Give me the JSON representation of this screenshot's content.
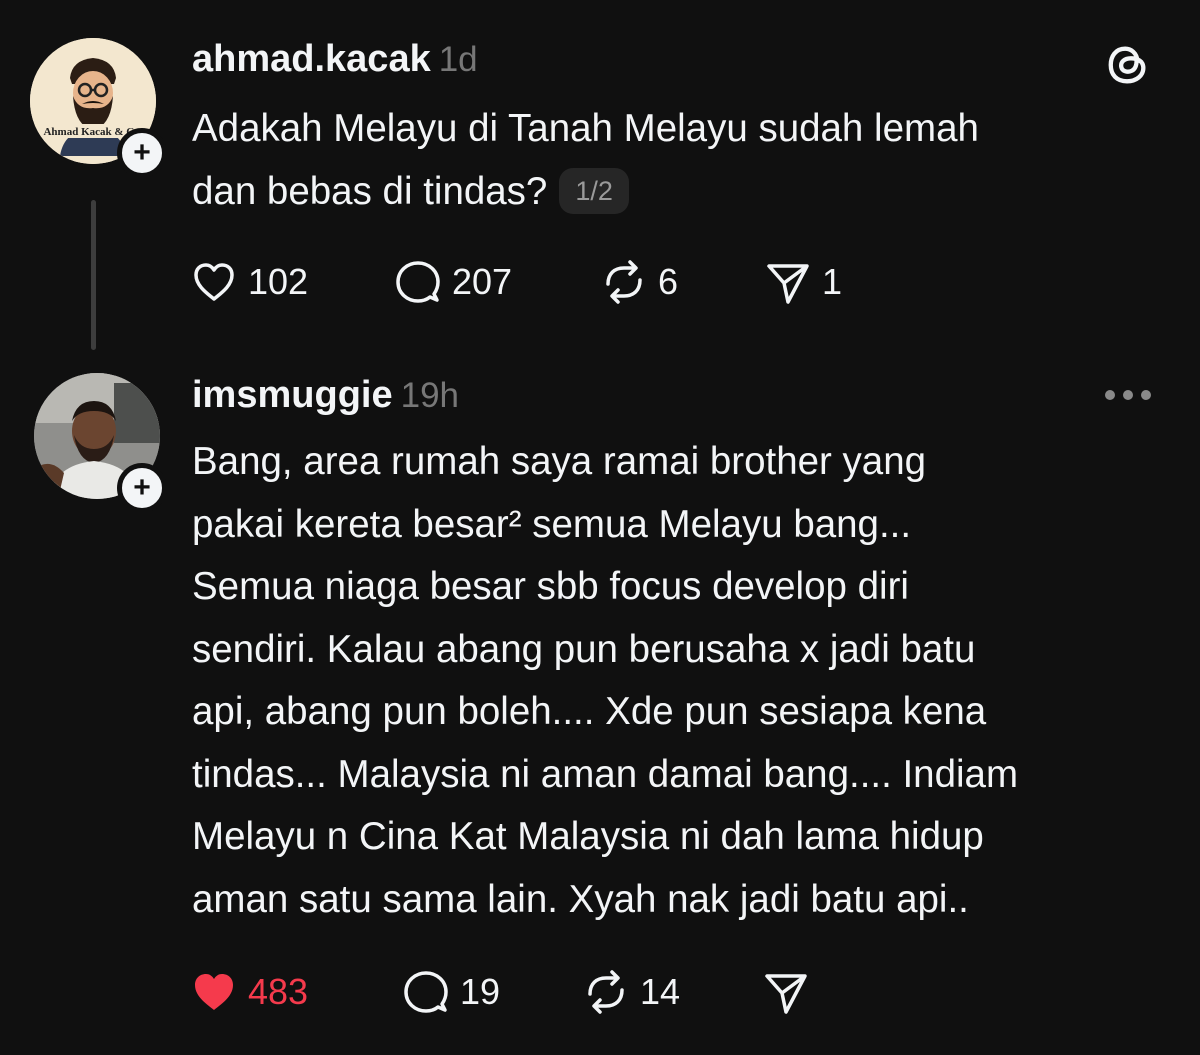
{
  "colors": {
    "background": "#101010",
    "text": "#f3f5f7",
    "muted": "#777777",
    "like_active": "#f53a4c"
  },
  "posts": [
    {
      "username": "ahmad.kacak",
      "time": "1d",
      "avatar_icon": "ahmad-kacak-logo-avatar",
      "lines": [
        "Adakah Melayu di Tanah Melayu sudah lemah",
        "dan bebas di tindas?"
      ],
      "page_badge": "1/2",
      "actions": {
        "likes": "102",
        "replies": "207",
        "reposts": "6",
        "shares": "1"
      }
    },
    {
      "username": "imsmuggie",
      "time": "19h",
      "avatar_icon": "user-photo-avatar",
      "lines": [
        "Bang, area rumah saya ramai brother yang",
        "pakai kereta besar² semua Melayu bang...",
        "Semua niaga besar sbb focus develop diri",
        "sendiri.  Kalau abang pun berusaha x jadi batu",
        "api, abang pun boleh.... Xde pun sesiapa kena",
        "tindas... Malaysia ni aman damai bang.... Indiam",
        "Melayu n Cina Kat Malaysia ni dah lama hidup",
        "aman satu sama lain. Xyah nak jadi batu api.."
      ],
      "actions": {
        "likes": "483",
        "liked": true,
        "replies": "19",
        "reposts": "14"
      }
    }
  ],
  "logo_text": "Ahmad Kacak & Co."
}
